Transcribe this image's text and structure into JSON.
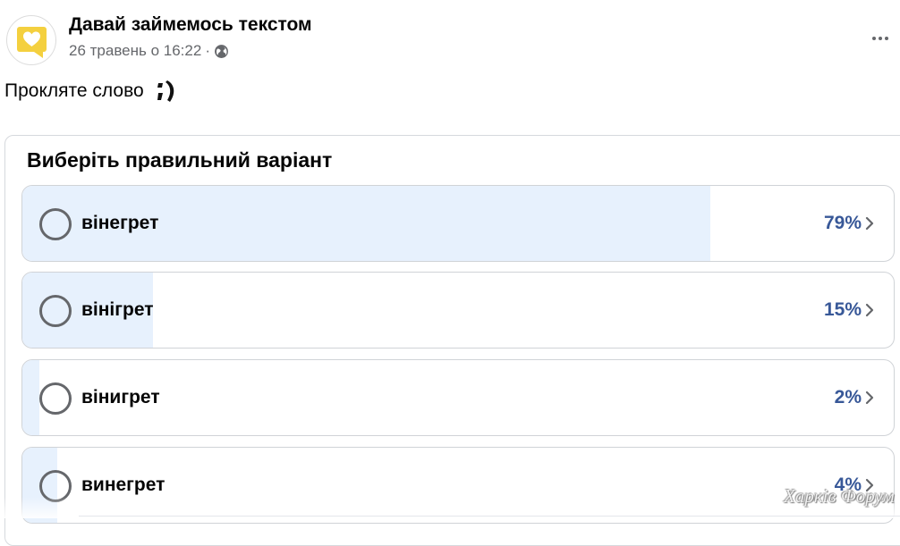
{
  "post": {
    "page_name": "Давай займемось текстом",
    "date": "26 травень о 16:22",
    "separator": "·",
    "audience_icon": "globe-icon",
    "more_icon": "more-dots-icon",
    "text": "Прокляте слово",
    "emoji": "winking-emoticon"
  },
  "poll": {
    "question": "Виберіть правильний варіант",
    "options": [
      {
        "label": "вінегрет",
        "percent_text": "79%",
        "percent": 79
      },
      {
        "label": "вінігрет",
        "percent_text": "15%",
        "percent": 15
      },
      {
        "label": "вінигрет",
        "percent_text": "2%",
        "percent": 2
      },
      {
        "label": "винегрет",
        "percent_text": "4%",
        "percent": 4
      }
    ]
  },
  "watermark": "Харків Форум",
  "colors": {
    "fill": "#e7f1fd",
    "percent": "#385898",
    "avatar_yellow": "#f4d03f",
    "secondary_text": "#65676b"
  }
}
